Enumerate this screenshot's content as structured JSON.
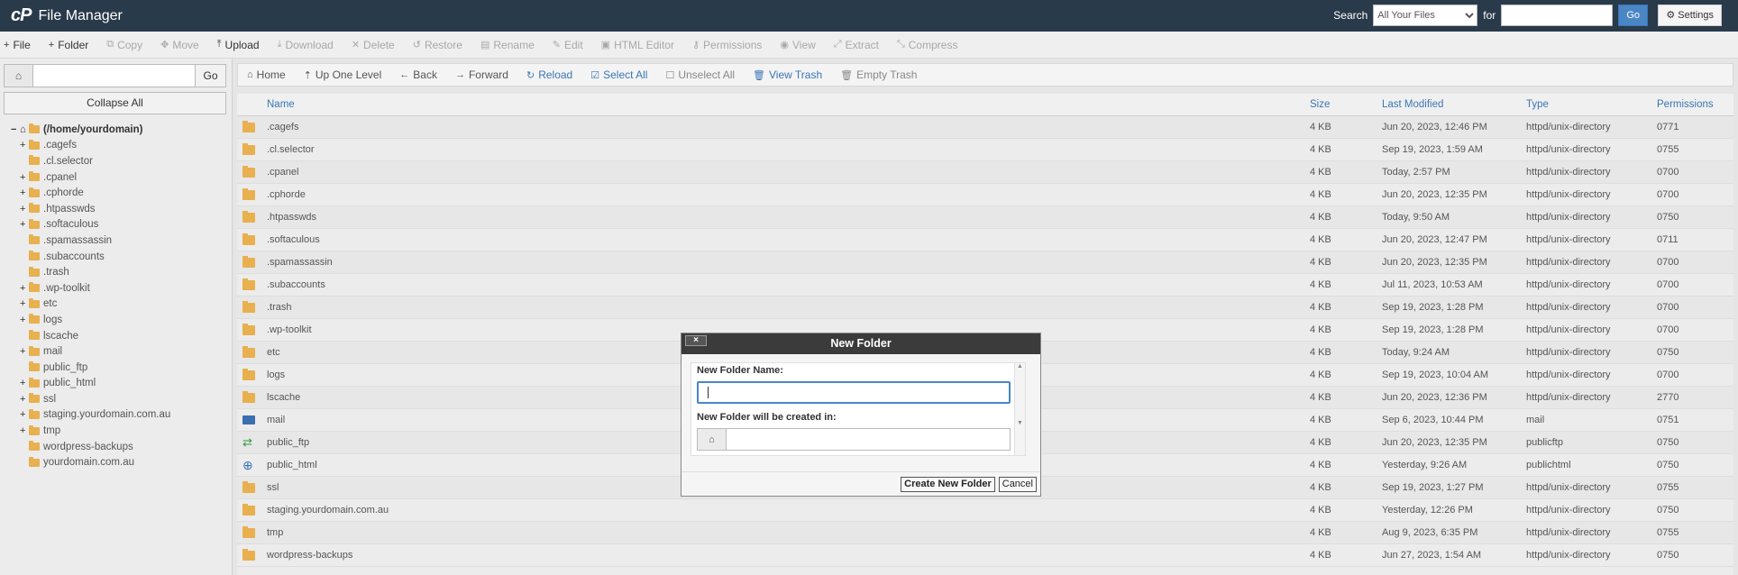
{
  "header": {
    "logo": "cP",
    "title": "File Manager",
    "search_label": "Search",
    "search_scope": "All Your Files",
    "for_label": "for",
    "go_label": "Go",
    "settings_label": "Settings"
  },
  "toolbar": [
    {
      "label": "File",
      "icon": "+",
      "disabled": false
    },
    {
      "label": "Folder",
      "icon": "+",
      "disabled": false
    },
    {
      "label": "Copy",
      "icon": "⧉",
      "disabled": true
    },
    {
      "label": "Move",
      "icon": "✥",
      "disabled": true
    },
    {
      "label": "Upload",
      "icon": "⤒",
      "disabled": false
    },
    {
      "label": "Download",
      "icon": "⤓",
      "disabled": true
    },
    {
      "label": "Delete",
      "icon": "✕",
      "disabled": true
    },
    {
      "label": "Restore",
      "icon": "↺",
      "disabled": true
    },
    {
      "label": "Rename",
      "icon": "▤",
      "disabled": true
    },
    {
      "label": "Edit",
      "icon": "✎",
      "disabled": true
    },
    {
      "label": "HTML Editor",
      "icon": "▣",
      "disabled": true
    },
    {
      "label": "Permissions",
      "icon": "⚷",
      "disabled": true
    },
    {
      "label": "View",
      "icon": "◉",
      "disabled": true
    },
    {
      "label": "Extract",
      "icon": "⤢",
      "disabled": true
    },
    {
      "label": "Compress",
      "icon": "⤡",
      "disabled": true
    }
  ],
  "left": {
    "go_label": "Go",
    "collapse_label": "Collapse All",
    "tree": [
      {
        "label": "(/home/yourdomain)",
        "toggle": "−",
        "root": true
      },
      {
        "label": ".cagefs",
        "toggle": "+"
      },
      {
        "label": ".cl.selector",
        "toggle": ""
      },
      {
        "label": ".cpanel",
        "toggle": "+"
      },
      {
        "label": ".cphorde",
        "toggle": "+"
      },
      {
        "label": ".htpasswds",
        "toggle": "+"
      },
      {
        "label": ".softaculous",
        "toggle": "+"
      },
      {
        "label": ".spamassassin",
        "toggle": ""
      },
      {
        "label": ".subaccounts",
        "toggle": ""
      },
      {
        "label": ".trash",
        "toggle": ""
      },
      {
        "label": ".wp-toolkit",
        "toggle": "+"
      },
      {
        "label": "etc",
        "toggle": "+"
      },
      {
        "label": "logs",
        "toggle": "+"
      },
      {
        "label": "lscache",
        "toggle": ""
      },
      {
        "label": "mail",
        "toggle": "+"
      },
      {
        "label": "public_ftp",
        "toggle": ""
      },
      {
        "label": "public_html",
        "toggle": "+"
      },
      {
        "label": "ssl",
        "toggle": "+"
      },
      {
        "label": "staging.yourdomain.com.au",
        "toggle": "+"
      },
      {
        "label": "tmp",
        "toggle": "+"
      },
      {
        "label": "wordpress-backups",
        "toggle": ""
      },
      {
        "label": "yourdomain.com.au",
        "toggle": ""
      }
    ]
  },
  "navbar": [
    {
      "label": "Home",
      "icon": "⌂",
      "style": "normal"
    },
    {
      "label": "Up One Level",
      "icon": "⇡",
      "style": "normal"
    },
    {
      "label": "Back",
      "icon": "←",
      "style": "normal"
    },
    {
      "label": "Forward",
      "icon": "→",
      "style": "normal"
    },
    {
      "label": "Reload",
      "icon": "↻",
      "style": "blue"
    },
    {
      "label": "Select All",
      "icon": "☑",
      "style": "blue"
    },
    {
      "label": "Unselect All",
      "icon": "☐",
      "style": "gray"
    },
    {
      "label": "View Trash",
      "icon": "🗑",
      "style": "blue"
    },
    {
      "label": "Empty Trash",
      "icon": "🗑",
      "style": "gray"
    }
  ],
  "table": {
    "headers": {
      "name": "Name",
      "size": "Size",
      "modified": "Last Modified",
      "type": "Type",
      "perms": "Permissions"
    },
    "rows": [
      {
        "icon": "folder-icon",
        "name": ".cagefs",
        "size": "4 KB",
        "modified": "Jun 20, 2023, 12:46 PM",
        "type": "httpd/unix-directory",
        "perms": "0771"
      },
      {
        "icon": "folder-icon",
        "name": ".cl.selector",
        "size": "4 KB",
        "modified": "Sep 19, 2023, 1:59 AM",
        "type": "httpd/unix-directory",
        "perms": "0755"
      },
      {
        "icon": "folder-icon",
        "name": ".cpanel",
        "size": "4 KB",
        "modified": "Today, 2:57 PM",
        "type": "httpd/unix-directory",
        "perms": "0700"
      },
      {
        "icon": "folder-icon",
        "name": ".cphorde",
        "size": "4 KB",
        "modified": "Jun 20, 2023, 12:35 PM",
        "type": "httpd/unix-directory",
        "perms": "0700"
      },
      {
        "icon": "folder-icon",
        "name": ".htpasswds",
        "size": "4 KB",
        "modified": "Today, 9:50 AM",
        "type": "httpd/unix-directory",
        "perms": "0750"
      },
      {
        "icon": "folder-icon",
        "name": ".softaculous",
        "size": "4 KB",
        "modified": "Jun 20, 2023, 12:47 PM",
        "type": "httpd/unix-directory",
        "perms": "0711"
      },
      {
        "icon": "folder-icon",
        "name": ".spamassassin",
        "size": "4 KB",
        "modified": "Jun 20, 2023, 12:35 PM",
        "type": "httpd/unix-directory",
        "perms": "0700"
      },
      {
        "icon": "folder-icon",
        "name": ".subaccounts",
        "size": "4 KB",
        "modified": "Jul 11, 2023, 10:53 AM",
        "type": "httpd/unix-directory",
        "perms": "0700"
      },
      {
        "icon": "folder-icon",
        "name": ".trash",
        "size": "4 KB",
        "modified": "Sep 19, 2023, 1:28 PM",
        "type": "httpd/unix-directory",
        "perms": "0700"
      },
      {
        "icon": "folder-icon",
        "name": ".wp-toolkit",
        "size": "4 KB",
        "modified": "Sep 19, 2023, 1:28 PM",
        "type": "httpd/unix-directory",
        "perms": "0700"
      },
      {
        "icon": "folder-icon",
        "name": "etc",
        "size": "4 KB",
        "modified": "Today, 9:24 AM",
        "type": "httpd/unix-directory",
        "perms": "0750"
      },
      {
        "icon": "folder-icon",
        "name": "logs",
        "size": "4 KB",
        "modified": "Sep 19, 2023, 10:04 AM",
        "type": "httpd/unix-directory",
        "perms": "0700"
      },
      {
        "icon": "folder-icon",
        "name": "lscache",
        "size": "4 KB",
        "modified": "Jun 20, 2023, 12:36 PM",
        "type": "httpd/unix-directory",
        "perms": "2770"
      },
      {
        "icon": "mail-icon",
        "name": "mail",
        "size": "4 KB",
        "modified": "Sep 6, 2023, 10:44 PM",
        "type": "mail",
        "perms": "0751"
      },
      {
        "icon": "ftp-icon",
        "name": "public_ftp",
        "size": "4 KB",
        "modified": "Jun 20, 2023, 12:35 PM",
        "type": "publicftp",
        "perms": "0750"
      },
      {
        "icon": "globe-icon",
        "name": "public_html",
        "size": "4 KB",
        "modified": "Yesterday, 9:26 AM",
        "type": "publichtml",
        "perms": "0750"
      },
      {
        "icon": "folder-icon",
        "name": "ssl",
        "size": "4 KB",
        "modified": "Sep 19, 2023, 1:27 PM",
        "type": "httpd/unix-directory",
        "perms": "0755"
      },
      {
        "icon": "folder-icon",
        "name": "staging.yourdomain.com.au",
        "size": "4 KB",
        "modified": "Yesterday, 12:26 PM",
        "type": "httpd/unix-directory",
        "perms": "0750"
      },
      {
        "icon": "folder-icon",
        "name": "tmp",
        "size": "4 KB",
        "modified": "Aug 9, 2023, 6:35 PM",
        "type": "httpd/unix-directory",
        "perms": "0755"
      },
      {
        "icon": "folder-icon",
        "name": "wordpress-backups",
        "size": "4 KB",
        "modified": "Jun 27, 2023, 1:54 AM",
        "type": "httpd/unix-directory",
        "perms": "0750"
      }
    ]
  },
  "modal": {
    "title": "New Folder",
    "close": "×",
    "name_label": "New Folder Name:",
    "name_value": "",
    "location_label": "New Folder will be created in:",
    "location_value": "",
    "create_label": "Create New Folder",
    "cancel_label": "Cancel"
  }
}
